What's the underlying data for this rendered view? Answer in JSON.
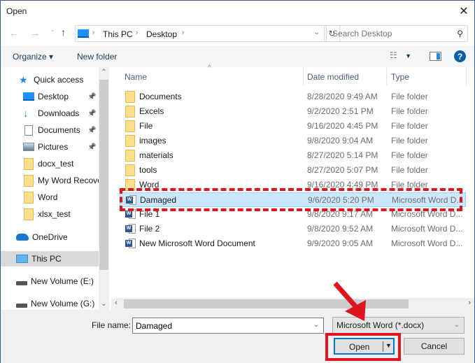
{
  "window": {
    "title": "Open",
    "close_label": "✕"
  },
  "nav": {
    "back": "←",
    "forward": "→",
    "recent": "⌄",
    "up": "↑",
    "breadcrumb": [
      "This PC",
      "Desktop"
    ],
    "refresh": "↻",
    "search_placeholder": "Search Desktop"
  },
  "toolbar": {
    "organize": "Organize ▾",
    "new_folder": "New folder",
    "help": "?"
  },
  "sidebar": {
    "items": [
      {
        "label": "Quick access",
        "icon": "star-icon",
        "pinned": false
      },
      {
        "label": "Desktop",
        "icon": "desktop-icon",
        "pinned": true
      },
      {
        "label": "Downloads",
        "icon": "download-icon",
        "pinned": true
      },
      {
        "label": "Documents",
        "icon": "documents-icon",
        "pinned": true
      },
      {
        "label": "Pictures",
        "icon": "pictures-icon",
        "pinned": true
      },
      {
        "label": "docx_test",
        "icon": "folder-icon",
        "pinned": false
      },
      {
        "label": "My Word Recove",
        "icon": "folder-icon",
        "pinned": false
      },
      {
        "label": "Word",
        "icon": "folder-icon",
        "pinned": false
      },
      {
        "label": "xlsx_test",
        "icon": "folder-icon",
        "pinned": false
      },
      {
        "label": "OneDrive",
        "icon": "cloud-icon",
        "pinned": false
      },
      {
        "label": "This PC",
        "icon": "computer-icon",
        "pinned": false,
        "selected": true
      },
      {
        "label": "New Volume (E:)",
        "icon": "drive-icon",
        "pinned": false
      },
      {
        "label": "New Volume (G:)",
        "icon": "drive-icon",
        "pinned": false
      }
    ]
  },
  "list": {
    "columns": [
      "Name",
      "Date modified",
      "Type"
    ],
    "rows": [
      {
        "name": "Documents",
        "date": "8/28/2020 9:49 AM",
        "type": "File folder",
        "kind": "folder"
      },
      {
        "name": "Excels",
        "date": "9/2/2020 2:51 PM",
        "type": "File folder",
        "kind": "folder"
      },
      {
        "name": "File",
        "date": "9/16/2020 4:45 PM",
        "type": "File folder",
        "kind": "folder"
      },
      {
        "name": "images",
        "date": "9/8/2020 9:04 AM",
        "type": "File folder",
        "kind": "folder"
      },
      {
        "name": "materials",
        "date": "8/27/2020 5:14 PM",
        "type": "File folder",
        "kind": "folder"
      },
      {
        "name": "tools",
        "date": "8/27/2020 5:07 PM",
        "type": "File folder",
        "kind": "folder"
      },
      {
        "name": "Word",
        "date": "9/16/2020 4:49 PM",
        "type": "File folder",
        "kind": "folder"
      },
      {
        "name": "Damaged",
        "date": "9/6/2020 5:20 PM",
        "type": "Microsoft Word D...",
        "kind": "word",
        "selected": true
      },
      {
        "name": "File 1",
        "date": "9/8/2020 9:17 AM",
        "type": "Microsoft Word D...",
        "kind": "word"
      },
      {
        "name": "File 2",
        "date": "9/8/2020 9:52 AM",
        "type": "Microsoft Word D...",
        "kind": "word"
      },
      {
        "name": "New Microsoft Word Document",
        "date": "9/9/2020 9:05 AM",
        "type": "Microsoft Word D...",
        "kind": "word"
      }
    ]
  },
  "footer": {
    "file_name_label": "File name:",
    "file_name_value": "Damaged",
    "filter_value": "Microsoft Word (*.docx)",
    "open_label": "Open",
    "cancel_label": "Cancel"
  },
  "annotation": {
    "color": "#e0141e"
  }
}
